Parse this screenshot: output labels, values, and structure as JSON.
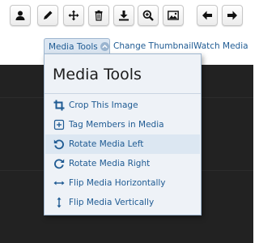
{
  "toolbar": {
    "buttons": [
      {
        "icon": "user-icon"
      },
      {
        "icon": "pencil-icon"
      },
      {
        "icon": "move-icon"
      },
      {
        "icon": "trash-icon"
      },
      {
        "icon": "download-icon"
      },
      {
        "icon": "zoom-in-icon"
      },
      {
        "icon": "image-icon"
      },
      {
        "icon": "arrow-left-icon"
      },
      {
        "icon": "arrow-right-icon"
      }
    ]
  },
  "links": {
    "media_tools": "Media Tools",
    "change_thumbnail": "Change Thumbnail",
    "watch_media": "Watch Media"
  },
  "menu": {
    "title": "Media Tools",
    "items": [
      {
        "label": "Crop This Image",
        "icon": "crop-icon"
      },
      {
        "label": "Tag Members in Media",
        "icon": "tag-plus-icon"
      },
      {
        "label": "Rotate Media Left",
        "icon": "rotate-left-icon"
      },
      {
        "label": "Rotate Media Right",
        "icon": "rotate-right-icon"
      },
      {
        "label": "Flip Media Horizontally",
        "icon": "flip-horizontal-icon"
      },
      {
        "label": "Flip Media Vertically",
        "icon": "flip-vertical-icon"
      }
    ]
  },
  "colors": {
    "link": "#1f5b93",
    "menu_bg": "#eef2f7",
    "media_bg": "#222222"
  }
}
